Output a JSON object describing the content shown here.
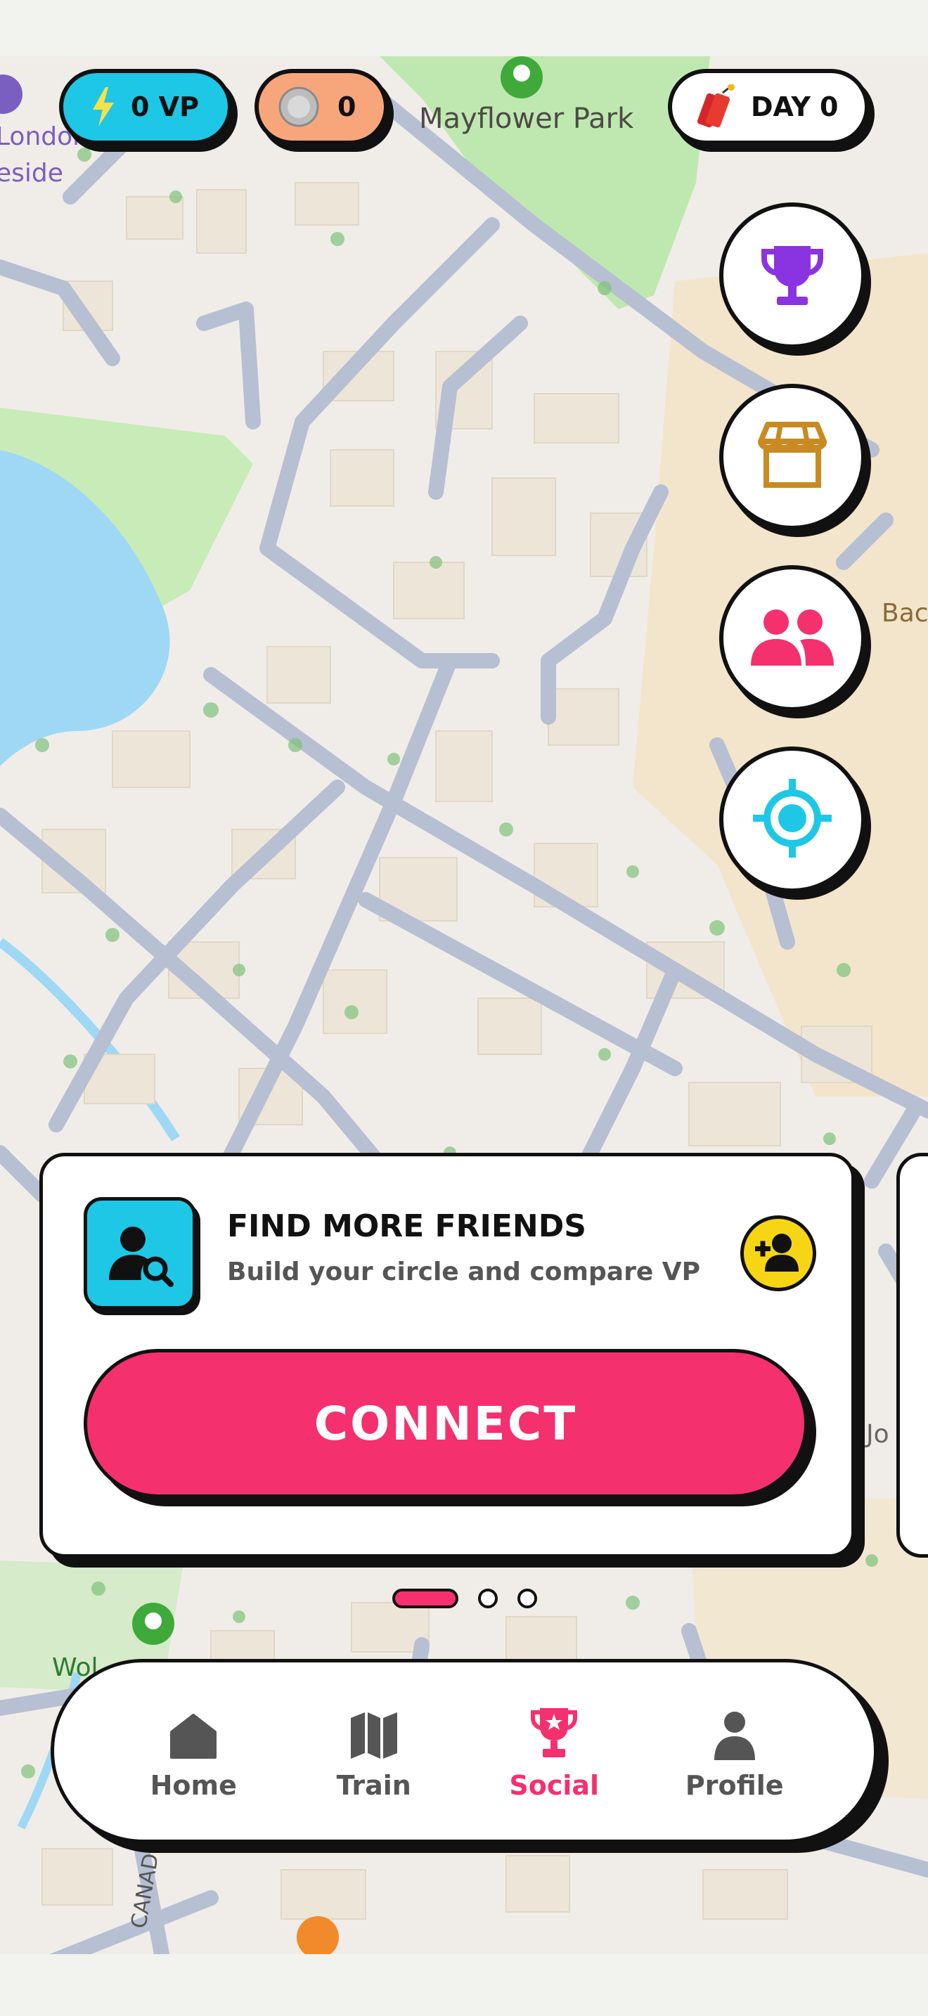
{
  "status": {
    "vp_label": "0 VP",
    "coins": "0",
    "day_label": "DAY 0"
  },
  "map": {
    "park_name": "Mayflower Park",
    "label_top_left_1": "London",
    "label_top_left_2": "eside",
    "label_right_1": "Bac",
    "label_right_2": "Jo",
    "label_bottom_left": "Wol",
    "street_label": "CANAD"
  },
  "side_buttons": {
    "leaderboard": "trophy-icon",
    "shop": "store-icon",
    "friends": "people-icon",
    "locate": "crosshair-icon"
  },
  "card": {
    "title": "FIND MORE FRIENDS",
    "subtitle": "Build your circle and compare VP",
    "button_label": "CONNECT"
  },
  "pager": {
    "total": 3,
    "active": 1
  },
  "nav": {
    "items": [
      {
        "label": "Home",
        "icon": "home-icon",
        "active": false
      },
      {
        "label": "Train",
        "icon": "map-icon",
        "active": false
      },
      {
        "label": "Social",
        "icon": "trophy-icon",
        "active": true
      },
      {
        "label": "Profile",
        "icon": "person-icon",
        "active": false
      }
    ]
  },
  "colors": {
    "accent_pink": "#f4306f",
    "vp_blue": "#1fc7e6",
    "coin_orange": "#f7a67c",
    "trophy_purple": "#8a33e0",
    "store_gold": "#c98a22",
    "friend_yellow": "#f6d515"
  }
}
